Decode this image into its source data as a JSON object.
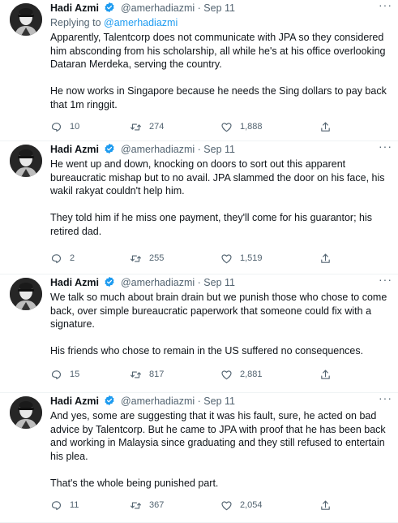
{
  "tweets": [
    {
      "name": "Hadi Azmi",
      "handle": "@amerhadiazmi",
      "sep": "·",
      "date": "Sep 11",
      "replying_prefix": "Replying to",
      "replying_to": "@amerhadiazmi",
      "paragraphs": [
        "Apparently, Talentcorp does not communicate with JPA so they considered him absconding from his scholarship, all while he's at his office overlooking Dataran Merdeka, serving the country.",
        "He now works in Singapore because he needs the Sing dollars to pay back that 1m ringgit."
      ],
      "replies": "10",
      "retweets": "274",
      "likes": "1,888"
    },
    {
      "name": "Hadi Azmi",
      "handle": "@amerhadiazmi",
      "sep": "·",
      "date": "Sep 11",
      "paragraphs": [
        "He went up and down, knocking on doors to sort out this apparent bureaucratic mishap but to no avail. JPA slammed the door on his face, his wakil rakyat couldn't help him.",
        "They told him if he miss one payment, they'll come for his guarantor; his retired dad."
      ],
      "replies": "2",
      "retweets": "255",
      "likes": "1,519"
    },
    {
      "name": "Hadi Azmi",
      "handle": "@amerhadiazmi",
      "sep": "·",
      "date": "Sep 11",
      "paragraphs": [
        "We talk so much about brain drain but we punish those who chose to come back, over simple bureaucratic paperwork that someone could fix with a signature.",
        "His friends who chose to remain in the US suffered no consequences."
      ],
      "replies": "15",
      "retweets": "817",
      "likes": "2,881"
    },
    {
      "name": "Hadi Azmi",
      "handle": "@amerhadiazmi",
      "sep": "·",
      "date": "Sep 11",
      "paragraphs": [
        "And yes, some are suggesting that it was his fault, sure, he acted on bad advice by Talentcorp. But he came to JPA with proof that he has been back and working in Malaysia since graduating and they still refused to entertain his plea.",
        "That's the whole being punished part."
      ],
      "replies": "11",
      "retweets": "367",
      "likes": "2,054"
    }
  ],
  "colors": {
    "accent": "#1d9bf0",
    "muted": "#536471",
    "text": "#0f1419",
    "divider": "#eff3f4"
  },
  "icons": {
    "reply": "reply-icon",
    "retweet": "retweet-icon",
    "like": "heart-icon",
    "share": "share-icon",
    "verified": "verified-badge-icon",
    "more": "more-icon"
  }
}
